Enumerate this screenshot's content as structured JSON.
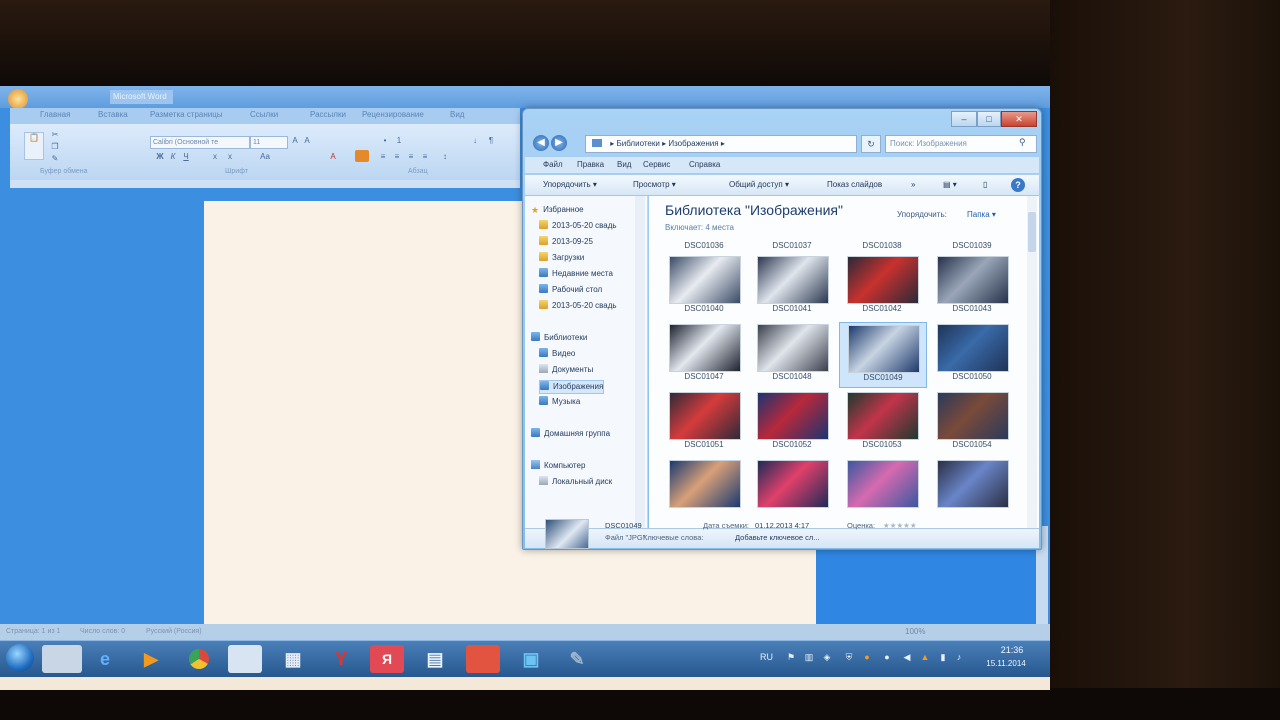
{
  "word": {
    "title": "Microsoft Word",
    "tabs": [
      "Главная",
      "Вставка",
      "Разметка страницы",
      "Ссылки",
      "Рассылки",
      "Рецензирование",
      "Вид"
    ],
    "font_name": "Calibri (Основной те",
    "font_size": "11",
    "groups": [
      "Буфер обмена",
      "Шрифт",
      "Абзац"
    ],
    "status": [
      "Страница: 1 из 1",
      "Число слов: 0",
      "Русский (Россия)"
    ],
    "zoom": "100%"
  },
  "explorer": {
    "address": [
      "Библиотеки",
      "Изображения"
    ],
    "search_placeholder": "Поиск: Изображения",
    "menu": [
      "Файл",
      "Правка",
      "Вид",
      "Сервис",
      "Справка"
    ],
    "commands": [
      "Упорядочить ▾",
      "Просмотр ▾",
      "Общий доступ ▾",
      "Показ слайдов",
      "»"
    ],
    "nav": {
      "favorites_header": "Избранное",
      "favorites": [
        "2013-05-20 свадь",
        "2013-09-25",
        "Загрузки",
        "Недавние места",
        "Рабочий стол",
        "2013-05-20 свадь"
      ],
      "libraries_header": "Библиотеки",
      "libraries": [
        "Видео",
        "Документы",
        "Изображения",
        "Музыка"
      ],
      "homegroup": "Домашняя группа",
      "computer": "Компьютер",
      "computer_items": [
        "Локальный диск"
      ]
    },
    "content": {
      "title": "Библиотека \"Изображения\"",
      "subtitle": "Включает: 4 места",
      "arrange_label": "Упорядочить:",
      "arrange_value": "Папка ▾",
      "top_captions": [
        "DSC01036",
        "DSC01037",
        "DSC01038",
        "DSC01039"
      ],
      "thumbs": [
        {
          "name": "DSC01040",
          "c1": "#3a4a66",
          "c2": "#e8ecf1"
        },
        {
          "name": "DSC01041",
          "c1": "#2c3850",
          "c2": "#dfe5ec"
        },
        {
          "name": "DSC01042",
          "c1": "#2a2a38",
          "c2": "#c9312e"
        },
        {
          "name": "DSC01043",
          "c1": "#26324a",
          "c2": "#9aa6b8"
        },
        {
          "name": "DSC01047",
          "c1": "#1e2230",
          "c2": "#e3e7ee"
        },
        {
          "name": "DSC01048",
          "c1": "#3a3f4c",
          "c2": "#e0e5ec"
        },
        {
          "name": "DSC01049",
          "c1": "#1d3a6e",
          "c2": "#c8d4e2"
        },
        {
          "name": "DSC01050",
          "c1": "#1f3458",
          "c2": "#3a6aa8"
        },
        {
          "name": "DSC01051",
          "c1": "#2f2a3a",
          "c2": "#d63b3b"
        },
        {
          "name": "DSC01052",
          "c1": "#1c3470",
          "c2": "#b8283a"
        },
        {
          "name": "DSC01053",
          "c1": "#1e3a30",
          "c2": "#c2344a"
        },
        {
          "name": "DSC01054",
          "c1": "#2a3a5a",
          "c2": "#7a4a3a"
        },
        {
          "name": "",
          "c1": "#1a3a70",
          "c2": "#d8a078"
        },
        {
          "name": "",
          "c1": "#1f2a58",
          "c2": "#e0406a"
        },
        {
          "name": "",
          "c1": "#3a58a0",
          "c2": "#d66ab0"
        },
        {
          "name": "",
          "c1": "#2a2f45",
          "c2": "#6a85c8"
        }
      ]
    },
    "details": {
      "name": "DSC01049",
      "type": "Файл \"JPG\"",
      "date_label": "Дата съемки:",
      "date_value": "01.12.2013 4:17",
      "keywords_label": "Ключевые слова:",
      "keywords_value": "Добавьте ключевое сл...",
      "rating_label": "Оценка:"
    }
  },
  "taskbar": {
    "lang": "RU",
    "time": "21:36",
    "date": "15.11.2014"
  },
  "colors": {
    "accent": "#3c8fe0",
    "explorer_frame": "#a9d2f5",
    "taskbar": "#27588f"
  }
}
